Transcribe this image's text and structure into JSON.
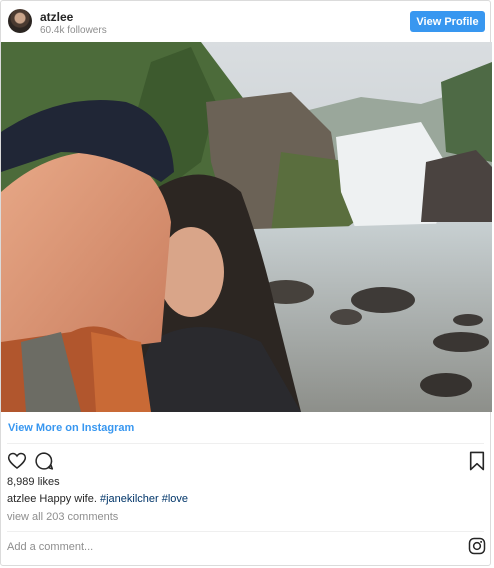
{
  "header": {
    "username": "atzlee",
    "followers": "60.4k followers",
    "view_profile_label": "View Profile"
  },
  "footer": {
    "view_more_label": "View More on Instagram",
    "likes": "8,989 likes",
    "caption": {
      "username": "atzlee",
      "text": "Happy wife.",
      "hashtags": [
        "#janekilcher",
        "#love"
      ]
    },
    "comments_link": "view all 203 comments",
    "add_comment_placeholder": "Add a comment..."
  },
  "icons": {
    "like": "heart-icon",
    "comment": "comment-bubble-icon",
    "save": "bookmark-icon",
    "brand": "instagram-logo-icon"
  },
  "colors": {
    "accent": "#3897f0",
    "hashtag": "#003569",
    "muted": "#8e8e8e"
  }
}
